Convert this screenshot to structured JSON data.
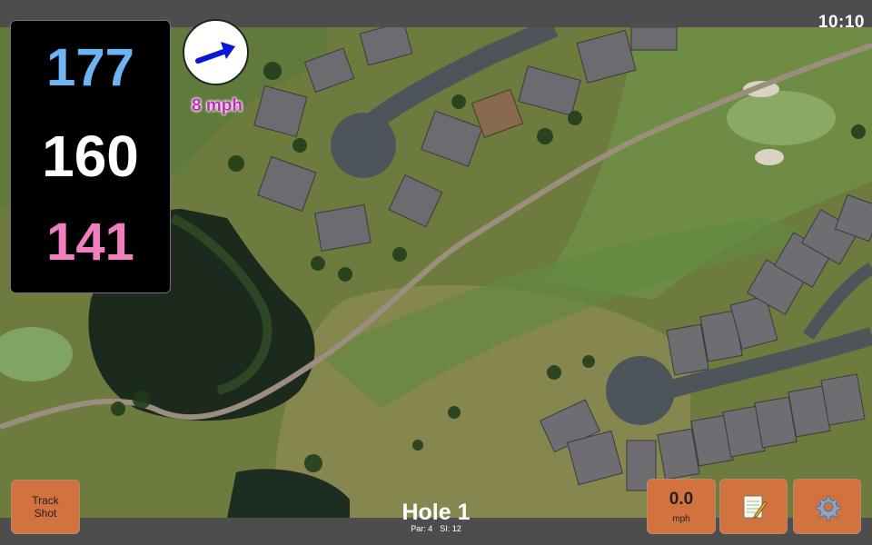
{
  "status": {
    "time": "10:10"
  },
  "distances": {
    "back": "177",
    "middle": "160",
    "front": "141",
    "colors": {
      "back": "#6cb4f2",
      "middle": "#ffffff",
      "front": "#f07fbf"
    }
  },
  "wind": {
    "speed_label": "8 mph",
    "direction_icon": "arrow-icon",
    "arrow_color": "#0a17d6",
    "label_color": "#c42bbd"
  },
  "track_shot": {
    "label": "Track\nShot",
    "color": "#d2733f"
  },
  "hole": {
    "title": "Hole 1",
    "par_label": "Par: 4",
    "si_label": "SI: 12"
  },
  "speed_button": {
    "value": "0.0",
    "unit": "mph"
  },
  "notes_button": {
    "icon": "notepad-icon"
  },
  "settings_button": {
    "icon": "gear-icon"
  },
  "map": {
    "style": "satellite",
    "colors": {
      "grass": "#6d7d3f",
      "water": "#1d2a1f",
      "green": "#87a66a",
      "path": "#9b8e7e",
      "road": "#4d545a"
    }
  }
}
